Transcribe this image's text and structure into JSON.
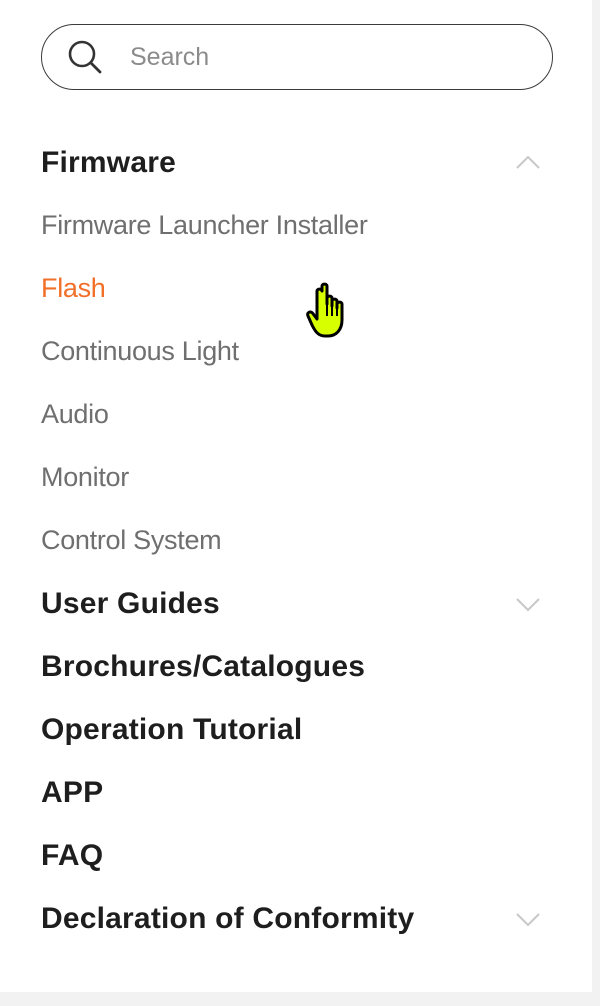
{
  "search": {
    "placeholder": "Search",
    "icon": "search-icon"
  },
  "menu": {
    "sections": [
      {
        "title": "Firmware",
        "expanded": true,
        "chevron": "chevron-up-icon",
        "items": [
          {
            "label": "Firmware Launcher Installer",
            "active": false
          },
          {
            "label": "Flash",
            "active": true
          },
          {
            "label": "Continuous Light",
            "active": false
          },
          {
            "label": "Audio",
            "active": false
          },
          {
            "label": "Monitor",
            "active": false
          },
          {
            "label": "Control System",
            "active": false
          }
        ]
      },
      {
        "title": "User Guides",
        "expanded": false,
        "chevron": "chevron-down-icon"
      },
      {
        "title": "Brochures/Catalogues"
      },
      {
        "title": "Operation Tutorial"
      },
      {
        "title": "APP"
      },
      {
        "title": "FAQ"
      },
      {
        "title": "Declaration of Conformity",
        "expanded": false,
        "chevron": "chevron-down-icon"
      }
    ]
  },
  "colors": {
    "accent": "#f26f28",
    "heading": "#1e1e1e",
    "subitem": "#6f6f6f",
    "chevron": "#c8c8c8",
    "cursor": "#d7ff00"
  },
  "cursor": {
    "type": "hand-pointer",
    "icon": "hand-cursor-icon"
  }
}
